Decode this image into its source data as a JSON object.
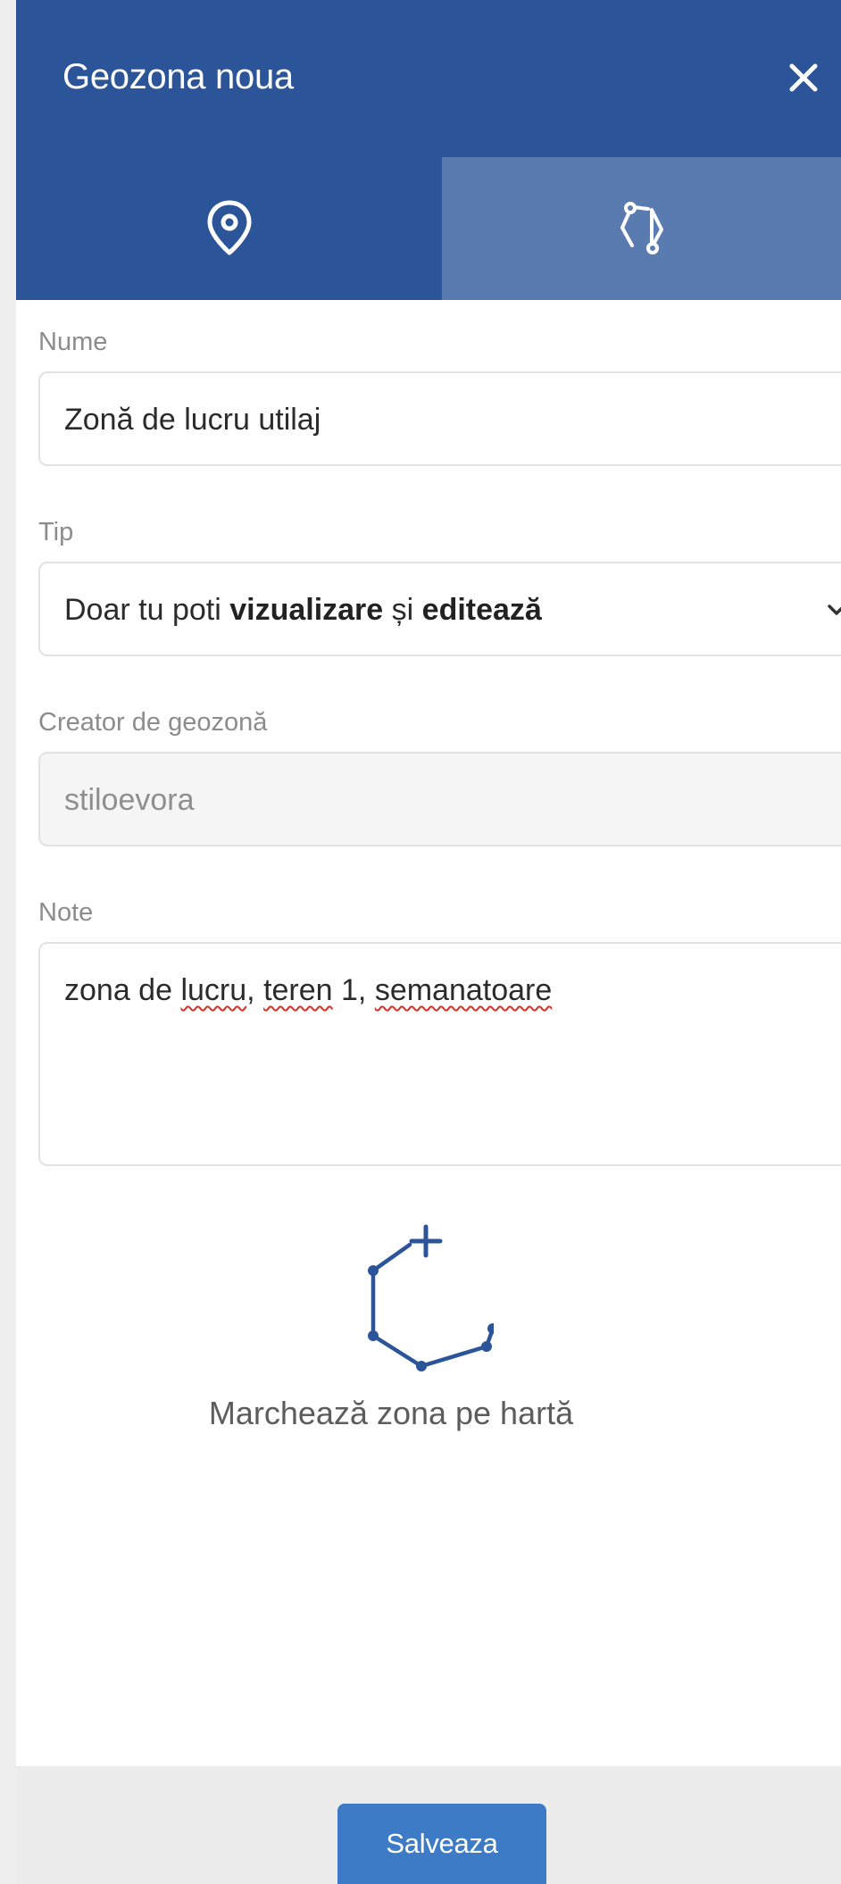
{
  "header": {
    "title": "Geozona noua",
    "close_icon": "close-icon",
    "color": "#2c5599"
  },
  "tabs": [
    {
      "icon": "map-pin-icon",
      "active": true,
      "color": "#2c5599"
    },
    {
      "icon": "polygon-icon",
      "active": false,
      "color": "#5a7bb0"
    }
  ],
  "form": {
    "name": {
      "label": "Nume",
      "value": "Zonă de lucru utilaj"
    },
    "type": {
      "label": "Tip",
      "value_prefix": "Doar tu poti ",
      "value_bold_1": "vizualizare",
      "value_middle": " și ",
      "value_bold_2": "editează"
    },
    "creator": {
      "label": "Creator de geozonă",
      "value": "stiloevora"
    },
    "notes": {
      "label": "Note",
      "value_part_1": "zona de ",
      "value_part_2": "lucru",
      "value_part_3": ", ",
      "value_part_4": "teren",
      "value_part_5": " 1, ",
      "value_part_6": "semanatoare"
    }
  },
  "draw_zone": {
    "icon": "draw-polygon-icon",
    "label": "Marchează zona pe hartă"
  },
  "footer": {
    "save_label": "Salveaza",
    "button_color": "#3d7bc7"
  }
}
